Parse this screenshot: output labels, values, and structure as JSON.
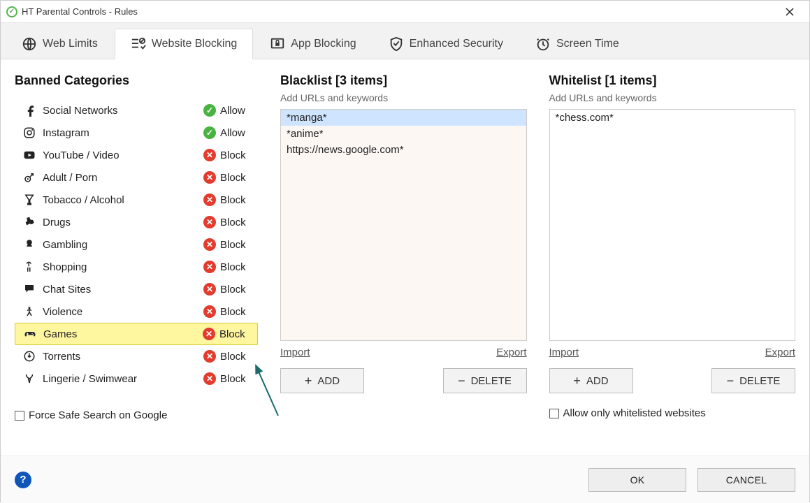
{
  "window": {
    "title": "HT Parental Controls - Rules"
  },
  "tabs": [
    {
      "label": "Web Limits"
    },
    {
      "label": "Website Blocking"
    },
    {
      "label": "App Blocking"
    },
    {
      "label": "Enhanced Security"
    },
    {
      "label": "Screen Time"
    }
  ],
  "categories": {
    "title": "Banned Categories",
    "items": [
      {
        "name": "Social Networks",
        "status": "Allow"
      },
      {
        "name": "Instagram",
        "status": "Allow"
      },
      {
        "name": "YouTube / Video",
        "status": "Block"
      },
      {
        "name": "Adult / Porn",
        "status": "Block"
      },
      {
        "name": "Tobacco / Alcohol",
        "status": "Block"
      },
      {
        "name": "Drugs",
        "status": "Block"
      },
      {
        "name": "Gambling",
        "status": "Block"
      },
      {
        "name": "Shopping",
        "status": "Block"
      },
      {
        "name": "Chat Sites",
        "status": "Block"
      },
      {
        "name": "Violence",
        "status": "Block"
      },
      {
        "name": "Games",
        "status": "Block",
        "highlight": true
      },
      {
        "name": "Torrents",
        "status": "Block"
      },
      {
        "name": "Lingerie / Swimwear",
        "status": "Block"
      }
    ],
    "safe_search": "Force Safe Search on Google"
  },
  "blacklist": {
    "title": "Blacklist [3 items]",
    "hint": "Add URLs and keywords",
    "items": [
      "*manga*",
      "*anime*",
      "https://news.google.com*"
    ],
    "import": "Import",
    "export": "Export",
    "add": "ADD",
    "delete": "DELETE"
  },
  "whitelist": {
    "title": "Whitelist [1 items]",
    "hint": "Add URLs and keywords",
    "items": [
      "*chess.com*"
    ],
    "import": "Import",
    "export": "Export",
    "add": "ADD",
    "delete": "DELETE",
    "allow_only": "Allow only whitelisted websites"
  },
  "footer": {
    "ok": "OK",
    "cancel": "CANCEL"
  }
}
